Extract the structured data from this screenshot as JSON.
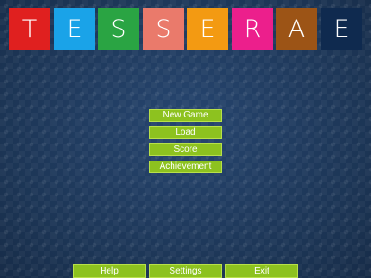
{
  "title": {
    "tiles": [
      {
        "letter": "T",
        "color": "#e0201f"
      },
      {
        "letter": "E",
        "color": "#1aa3e8"
      },
      {
        "letter": "S",
        "color": "#2aa443"
      },
      {
        "letter": "S",
        "color": "#ea7a6b"
      },
      {
        "letter": "E",
        "color": "#f39a12"
      },
      {
        "letter": "R",
        "color": "#ec1f8c"
      },
      {
        "letter": "A",
        "color": "#9c5416"
      },
      {
        "letter": "E",
        "color": "#0f2a4f"
      }
    ]
  },
  "menu": {
    "new_game": "New Game",
    "load": "Load",
    "score": "Score",
    "achievement": "Achievement"
  },
  "bottom": {
    "help": "Help",
    "settings": "Settings",
    "exit": "Exit"
  },
  "colors": {
    "button_green": "#8dc21f",
    "background": "#1f3a5e"
  }
}
